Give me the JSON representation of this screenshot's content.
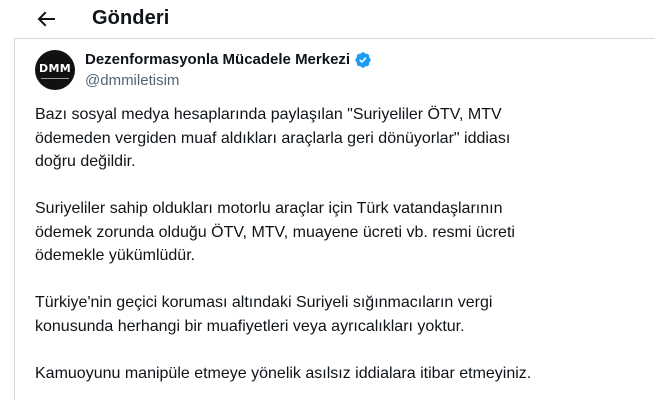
{
  "header": {
    "title": "Gönderi",
    "back_icon": "arrow-left-icon"
  },
  "author": {
    "display_name": "Dezenformasyonla Mücadele Merkezi",
    "handle": "@dmmiletisim",
    "avatar_text": "DMM",
    "verified_icon": "verified-badge-icon",
    "verified_color": "#1d9bf0"
  },
  "tweet": {
    "paragraphs": [
      {
        "lines": [
          "Bazı sosyal medya hesaplarında paylaşılan \"Suriyeliler ÖTV, MTV",
          "ödemeden vergiden muaf aldıkları araçlarla geri dönüyorlar\" iddiası",
          "doğru değildir."
        ]
      },
      {
        "lines": [
          "Suriyeliler sahip oldukları motorlu araçlar için Türk vatandaşlarının",
          "ödemek zorunda olduğu ÖTV, MTV, muayene ücreti vb. resmi ücreti",
          "ödemekle yükümlüdür."
        ]
      },
      {
        "lines": [
          "Türkiye'nin geçici koruması altındaki Suriyeli sığınmacıların vergi",
          "konusunda herhangi bir muafiyetleri veya ayrıcalıkları yoktur."
        ]
      },
      {
        "lines": [
          "Kamuoyunu manipüle etmeye yönelik asılsız iddialara itibar etmeyiniz."
        ]
      }
    ]
  },
  "colors": {
    "text": "#0f1419",
    "secondary_text": "#536471",
    "border": "#cfd9de",
    "accent": "#1d9bf0"
  }
}
